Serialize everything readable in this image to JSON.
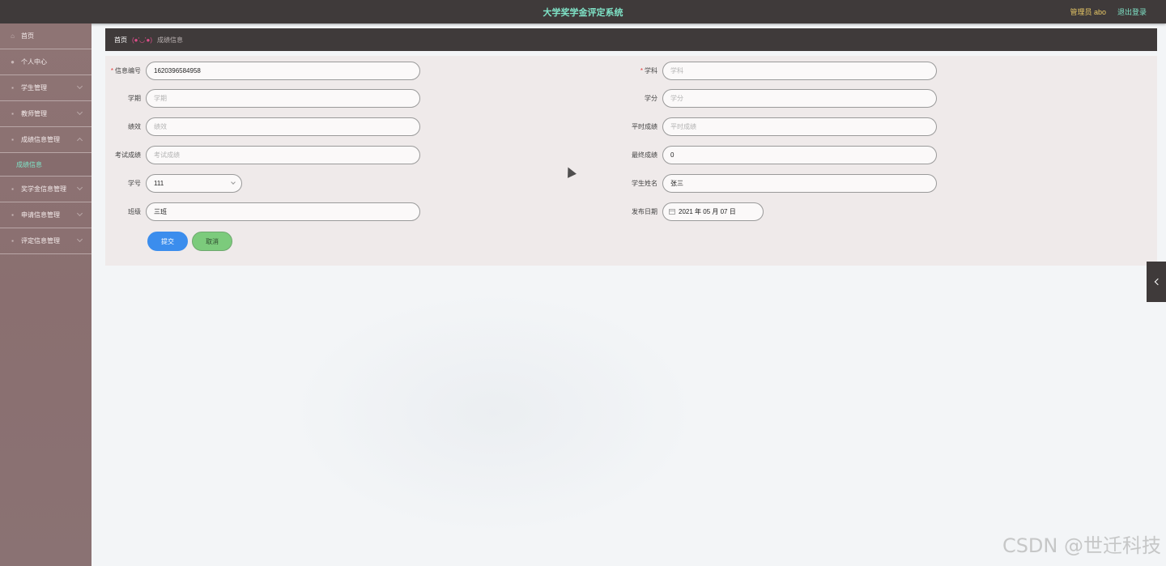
{
  "header": {
    "title": "大学奖学金评定系统",
    "user": "管理员 abo",
    "logout": "退出登录"
  },
  "sidebar": {
    "items": [
      {
        "label": "首页",
        "icon": "home-icon"
      },
      {
        "label": "个人中心",
        "icon": "user-icon"
      },
      {
        "label": "学生管理",
        "icon": "users-icon"
      },
      {
        "label": "教师管理",
        "icon": "teacher-icon"
      },
      {
        "label": "成绩信息管理",
        "icon": "grade-icon"
      },
      {
        "label": "奖学金信息管理",
        "icon": "award-icon"
      },
      {
        "label": "申请信息管理",
        "icon": "apply-icon"
      },
      {
        "label": "评定信息管理",
        "icon": "evaluate-icon"
      }
    ],
    "sub_active": "成绩信息"
  },
  "breadcrumb": {
    "home": "首页",
    "emoticon": "(●'◡'●)",
    "current": "成绩信息"
  },
  "form": {
    "info_no": {
      "label": "信息编号",
      "value": "1620396584958"
    },
    "subject": {
      "label": "学科",
      "placeholder": "学科"
    },
    "semester": {
      "label": "学期",
      "placeholder": "学期"
    },
    "credit": {
      "label": "学分",
      "placeholder": "学分"
    },
    "gpa": {
      "label": "绩效",
      "placeholder": "绩效"
    },
    "usual_score": {
      "label": "平时成绩",
      "placeholder": "平时成绩"
    },
    "exam_score": {
      "label": "考试成绩",
      "placeholder": "考试成绩"
    },
    "final_score": {
      "label": "最终成绩",
      "value": "0"
    },
    "student_no": {
      "label": "学号",
      "value": "111"
    },
    "student_name": {
      "label": "学生姓名",
      "value": "张三"
    },
    "class": {
      "label": "班级",
      "value": "三班"
    },
    "publish_date": {
      "label": "发布日期",
      "value": "2021 年 05 月 07 日"
    },
    "required_mark": "*",
    "submit": "提交",
    "cancel": "取消"
  },
  "watermark": "CSDN @世迁科技",
  "colors": {
    "topbar": "#3f3a3a",
    "title": "#7fe3c7",
    "user": "#e8c866",
    "sidebar": "#8e7474",
    "submit": "#3b8ded",
    "cancel": "#7ccb7c"
  }
}
